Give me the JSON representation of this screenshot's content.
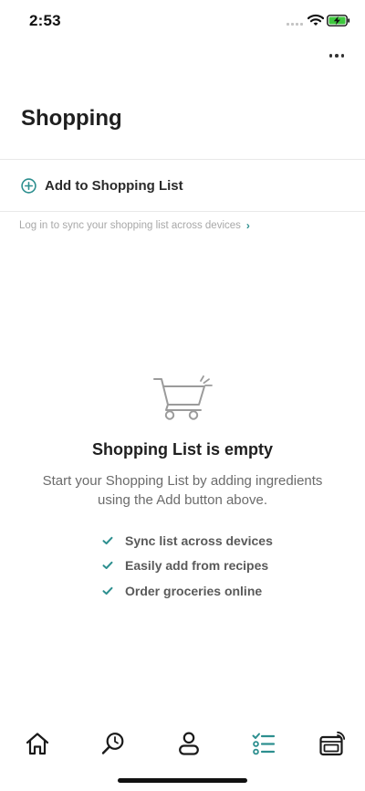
{
  "status_bar": {
    "time": "2:53"
  },
  "colors": {
    "accent": "#2d8f8f",
    "battery_green": "#3ec83e",
    "text_dark": "#1f1f1f",
    "text_muted": "#6b6b6b"
  },
  "header": {
    "title": "Shopping",
    "more_icon": "more-horizontal-icon"
  },
  "add_row": {
    "label": "Add to Shopping List",
    "icon": "plus-circle-icon"
  },
  "sync_link": {
    "text": "Log in to sync your shopping list across devices",
    "chevron": "›"
  },
  "empty_state": {
    "icon": "shopping-cart-icon",
    "title": "Shopping List is empty",
    "description": "Start your Shopping List by adding ingredients using the Add button above.",
    "benefits": [
      "Sync list across devices",
      "Easily add from recipes",
      "Order groceries online"
    ]
  },
  "bottom_nav": {
    "active": "shopping",
    "items": [
      {
        "id": "home",
        "icon": "home-icon"
      },
      {
        "id": "search",
        "icon": "search-icon"
      },
      {
        "id": "profile",
        "icon": "profile-icon"
      },
      {
        "id": "shopping",
        "icon": "checklist-icon"
      },
      {
        "id": "appliance",
        "icon": "connected-oven-icon"
      }
    ]
  }
}
